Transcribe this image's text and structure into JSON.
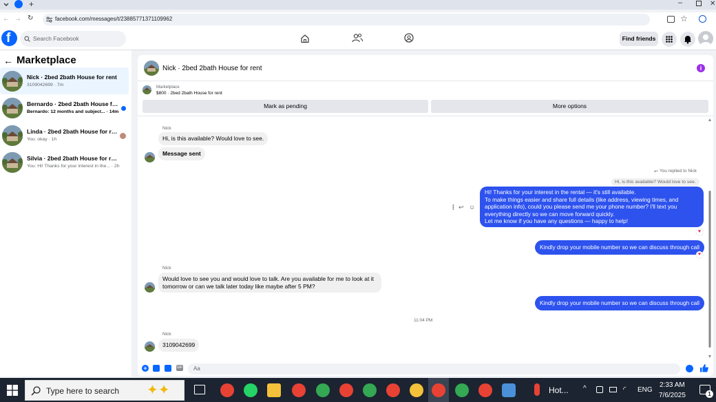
{
  "browser": {
    "url": "facebook.com/messages/t/23885771371109962"
  },
  "header": {
    "search_placeholder": "Search Facebook",
    "find_friends": "Find friends"
  },
  "sidebar": {
    "back_title": "Marketplace",
    "conversations": [
      {
        "name": "Nick · 2bed 2bath House for rent",
        "preview": "3109042699 · 7m",
        "active": true,
        "unread": false
      },
      {
        "name": "Bernardo · 2bed 2bath House for...",
        "preview": "Bernardo: 12 months and subject... · 14m",
        "active": false,
        "unread": true
      },
      {
        "name": "Linda · 2bed 2bath House for rent",
        "preview": "You: okay · 1h",
        "active": false,
        "unread": false
      },
      {
        "name": "Silvia · 2bed 2bath House for rent",
        "preview": "You: Hi! Thanks for your interest in the... · 2h",
        "active": false,
        "unread": false
      }
    ]
  },
  "chat": {
    "title": "Nick · 2bed 2bath House for rent",
    "marketplace_label": "Marketplace",
    "listing": "$800 · 2bed 2bath House for rent",
    "mark_pending": "Mark as pending",
    "more_options": "More options",
    "messages": {
      "sender1": "Nick",
      "m1": "Hi, is this available? Would love to see.",
      "m2": "Message sent",
      "replied_label": "You replied to Nick",
      "quoted": "Hi, is this available? Would love to see.",
      "m3": "Hi! Thanks for your interest in the rental — it's still available.\nTo make things easier and share full details (like address, viewing times, and application info), could you please send me your phone number? I'll text you everything directly so we can move forward quickly.\nLet me know if you have any questions — happy to help!",
      "m4": "Kindly drop your mobile number so we can discuss through call",
      "sender2": "Nick",
      "m5": "Would love to see you and would love to talk. Are you available for me to look at it tomorrow or can we talk later today like maybe after 5 PM?",
      "m6": "Kindly drop your mobile number so we can discuss through call",
      "timestamp": "11:04 PM",
      "sender3": "Nick",
      "m7": "3109042699"
    },
    "input_placeholder": "Aa"
  },
  "taskbar": {
    "search_text": "Type here to search",
    "weather": "Hot...",
    "lang": "ENG",
    "time": "2:33 AM",
    "date": "7/6/2025",
    "notif_count": "1"
  },
  "colors": {
    "accent": "#0866ff",
    "outgoing_bubble": "#2d52ee",
    "info_purple": "#9b30e8"
  }
}
